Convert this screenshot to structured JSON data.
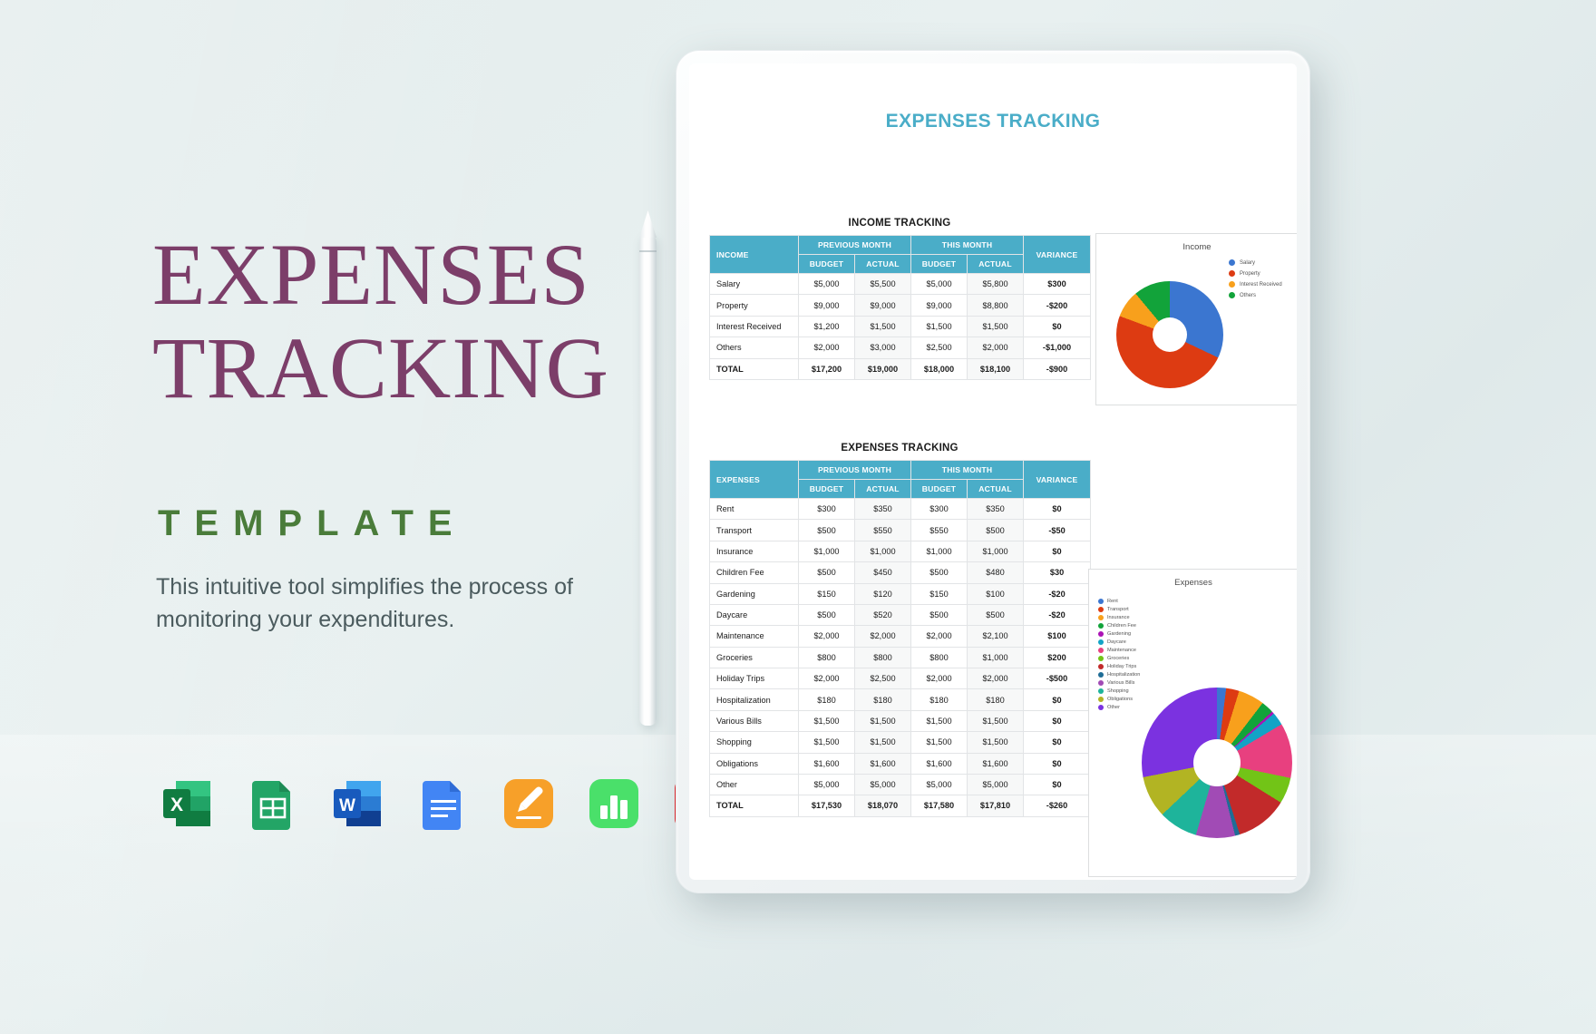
{
  "marketing": {
    "headline_line1": "EXPENSES",
    "headline_line2": "TRACKING",
    "template_word": "TEMPLATE",
    "subtitle": "This intuitive tool simplifies the process of monitoring your expenditures.",
    "headline_color": "#7c3e69",
    "template_color": "#4a7c3a",
    "app_icons": [
      {
        "name": "excel-icon",
        "label": "X"
      },
      {
        "name": "google-sheets-icon",
        "label": ""
      },
      {
        "name": "word-icon",
        "label": "W"
      },
      {
        "name": "google-docs-icon",
        "label": ""
      },
      {
        "name": "apple-pages-icon",
        "label": ""
      },
      {
        "name": "apple-numbers-icon",
        "label": ""
      },
      {
        "name": "pdf-icon",
        "label": ""
      }
    ]
  },
  "document": {
    "title": "EXPENSES TRACKING",
    "accent_color": "#4aadc8",
    "income_section_title": "INCOME TRACKING",
    "expenses_section_title": "EXPENSES TRACKING",
    "group_headers": {
      "previous_month": "PREVIOUS MONTH",
      "this_month": "THIS MONTH",
      "variance": "VARIANCE",
      "budget": "BUDGET",
      "actual": "ACTUAL"
    },
    "income_row_header": "INCOME",
    "expenses_row_header": "EXPENSES",
    "income_rows": [
      {
        "label": "Salary",
        "prev_budget": "$5,000",
        "prev_actual": "$5,500",
        "this_budget": "$5,000",
        "this_actual": "$5,800",
        "variance": "$300"
      },
      {
        "label": "Property",
        "prev_budget": "$9,000",
        "prev_actual": "$9,000",
        "this_budget": "$9,000",
        "this_actual": "$8,800",
        "variance": "-$200"
      },
      {
        "label": "Interest Received",
        "prev_budget": "$1,200",
        "prev_actual": "$1,500",
        "this_budget": "$1,500",
        "this_actual": "$1,500",
        "variance": "$0"
      },
      {
        "label": "Others",
        "prev_budget": "$2,000",
        "prev_actual": "$3,000",
        "this_budget": "$2,500",
        "this_actual": "$2,000",
        "variance": "-$1,000"
      },
      {
        "label": "TOTAL",
        "prev_budget": "$17,200",
        "prev_actual": "$19,000",
        "this_budget": "$18,000",
        "this_actual": "$18,100",
        "variance": "-$900",
        "total": true
      }
    ],
    "expenses_rows": [
      {
        "label": "Rent",
        "prev_budget": "$300",
        "prev_actual": "$350",
        "this_budget": "$300",
        "this_actual": "$350",
        "variance": "$0"
      },
      {
        "label": "Transport",
        "prev_budget": "$500",
        "prev_actual": "$550",
        "this_budget": "$550",
        "this_actual": "$500",
        "variance": "-$50"
      },
      {
        "label": "Insurance",
        "prev_budget": "$1,000",
        "prev_actual": "$1,000",
        "this_budget": "$1,000",
        "this_actual": "$1,000",
        "variance": "$0"
      },
      {
        "label": "Children Fee",
        "prev_budget": "$500",
        "prev_actual": "$450",
        "this_budget": "$500",
        "this_actual": "$480",
        "variance": "$30"
      },
      {
        "label": "Gardening",
        "prev_budget": "$150",
        "prev_actual": "$120",
        "this_budget": "$150",
        "this_actual": "$100",
        "variance": "-$20"
      },
      {
        "label": "Daycare",
        "prev_budget": "$500",
        "prev_actual": "$520",
        "this_budget": "$500",
        "this_actual": "$500",
        "variance": "-$20"
      },
      {
        "label": "Maintenance",
        "prev_budget": "$2,000",
        "prev_actual": "$2,000",
        "this_budget": "$2,000",
        "this_actual": "$2,100",
        "variance": "$100"
      },
      {
        "label": "Groceries",
        "prev_budget": "$800",
        "prev_actual": "$800",
        "this_budget": "$800",
        "this_actual": "$1,000",
        "variance": "$200"
      },
      {
        "label": "Holiday Trips",
        "prev_budget": "$2,000",
        "prev_actual": "$2,500",
        "this_budget": "$2,000",
        "this_actual": "$2,000",
        "variance": "-$500"
      },
      {
        "label": "Hospitalization",
        "prev_budget": "$180",
        "prev_actual": "$180",
        "this_budget": "$180",
        "this_actual": "$180",
        "variance": "$0"
      },
      {
        "label": "Various Bills",
        "prev_budget": "$1,500",
        "prev_actual": "$1,500",
        "this_budget": "$1,500",
        "this_actual": "$1,500",
        "variance": "$0"
      },
      {
        "label": "Shopping",
        "prev_budget": "$1,500",
        "prev_actual": "$1,500",
        "this_budget": "$1,500",
        "this_actual": "$1,500",
        "variance": "$0"
      },
      {
        "label": "Obligations",
        "prev_budget": "$1,600",
        "prev_actual": "$1,600",
        "this_budget": "$1,600",
        "this_actual": "$1,600",
        "variance": "$0"
      },
      {
        "label": "Other",
        "prev_budget": "$5,000",
        "prev_actual": "$5,000",
        "this_budget": "$5,000",
        "this_actual": "$5,000",
        "variance": "$0"
      },
      {
        "label": "TOTAL",
        "prev_budget": "$17,530",
        "prev_actual": "$18,070",
        "this_budget": "$17,580",
        "this_actual": "$17,810",
        "variance": "-$260",
        "total": true
      }
    ]
  },
  "chart_data": [
    {
      "type": "pie",
      "title": "Income",
      "legend_position": "right",
      "categories": [
        "Salary",
        "Property",
        "Interest Received",
        "Others"
      ],
      "values": [
        5800,
        8800,
        1500,
        2000
      ],
      "colors": [
        "#3b76d0",
        "#dd3b12",
        "#f8a01c",
        "#12a33a"
      ]
    },
    {
      "type": "pie",
      "title": "Expenses",
      "legend_position": "left",
      "categories": [
        "Rent",
        "Transport",
        "Insurance",
        "Children Fee",
        "Gardening",
        "Daycare",
        "Maintenance",
        "Groceries",
        "Holiday Trips",
        "Hospitalization",
        "Various Bills",
        "Shopping",
        "Obligations",
        "Other"
      ],
      "values": [
        350,
        500,
        1000,
        480,
        100,
        500,
        2100,
        1000,
        2000,
        180,
        1500,
        1500,
        1600,
        5000
      ],
      "colors": [
        "#3b76d0",
        "#dd3b12",
        "#f8a01c",
        "#12a33a",
        "#ab13b5",
        "#12a3c6",
        "#e8407f",
        "#72c417",
        "#c22a2a",
        "#1f6d96",
        "#a14bb5",
        "#1eb49b",
        "#b2b423",
        "#7b32e0"
      ]
    }
  ]
}
